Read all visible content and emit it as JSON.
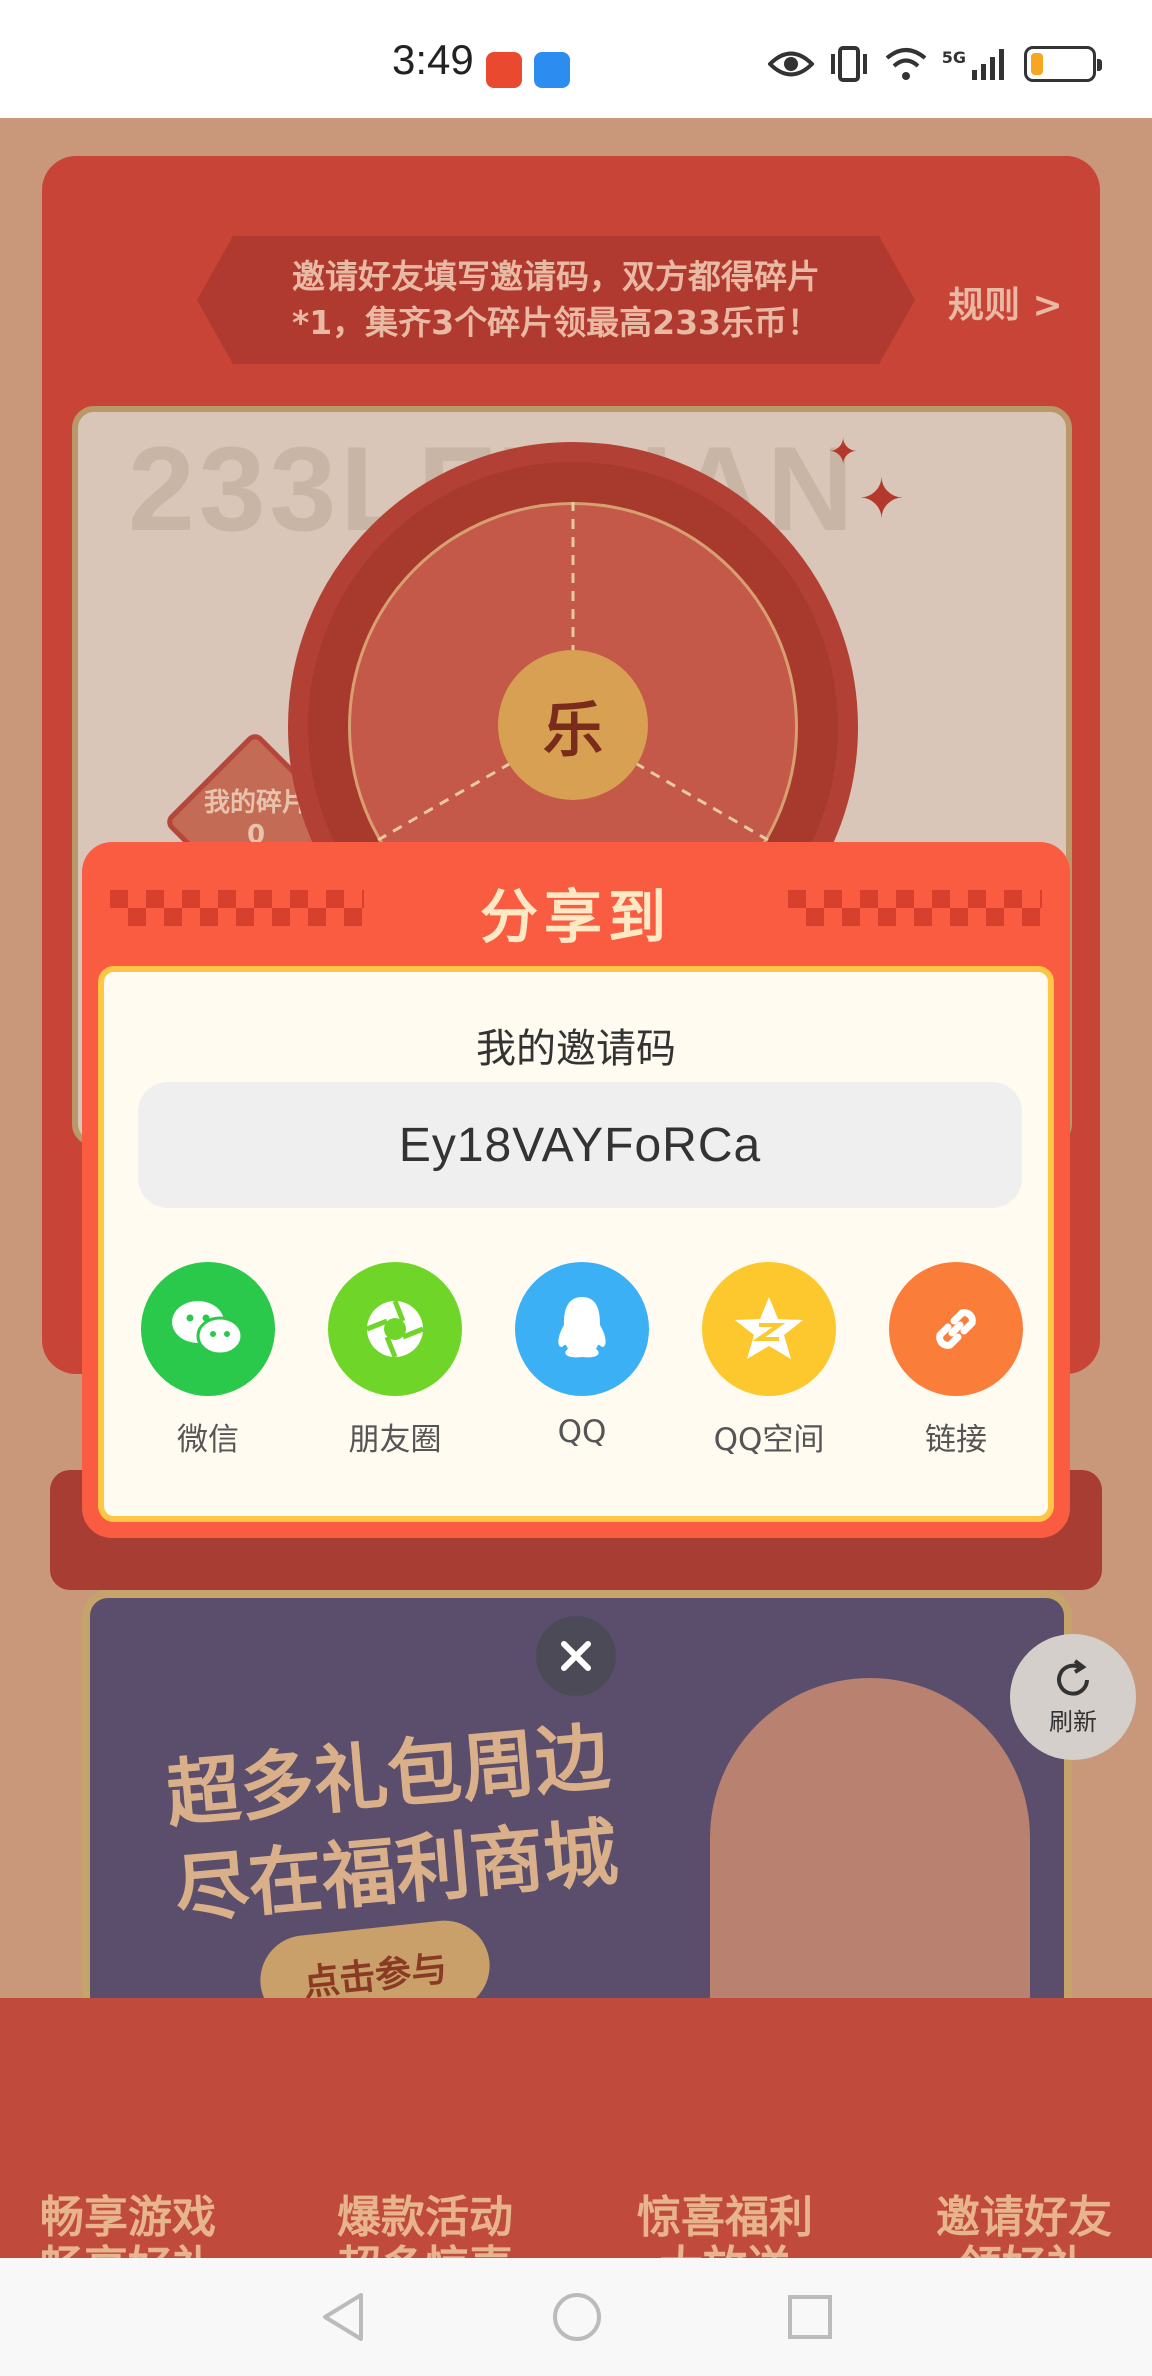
{
  "status_bar": {
    "time": "3:49",
    "network": "5G",
    "battery_level": 0.2,
    "battery_color": "#f5a623"
  },
  "background": {
    "banner_text_line1": "邀请好友填写邀请码，双方都得碎片",
    "banner_text_line2": "*1，集齐3个碎片领最高233乐币！",
    "rules_link": "规则 >",
    "my_pieces_label": "我的碎片",
    "my_pieces_count": "0",
    "wheel_center_label": "乐",
    "mall_title_line1": "超多礼包周边",
    "mall_title_line2": "尽在福利商城",
    "mall_button": "点击参与",
    "refresh_label": "刷新",
    "features": [
      {
        "line1": "畅享游戏",
        "line2": "畅享好礼"
      },
      {
        "line1": "爆款活动",
        "line2": "超多惊喜"
      },
      {
        "line1": "惊喜福利",
        "line2": "大放送"
      },
      {
        "line1": "邀请好友",
        "line2": "领好礼"
      }
    ]
  },
  "share_dialog": {
    "title": "分享到",
    "invite_label": "我的邀请码",
    "invite_code": "Ey18VAYFoRCa",
    "options": [
      {
        "label": "微信",
        "icon": "wechat-icon",
        "color": "#2ac84b"
      },
      {
        "label": "朋友圈",
        "icon": "moments-icon",
        "color": "#6fd629"
      },
      {
        "label": "QQ",
        "icon": "qq-icon",
        "color": "#3cb0f5"
      },
      {
        "label": "QQ空间",
        "icon": "qzone-icon",
        "color": "#fcc82d"
      },
      {
        "label": "链接",
        "icon": "link-icon",
        "color": "#fb7d3a"
      }
    ]
  },
  "navigation": {
    "back": "back-icon",
    "home": "home-icon",
    "recents": "recents-icon"
  }
}
